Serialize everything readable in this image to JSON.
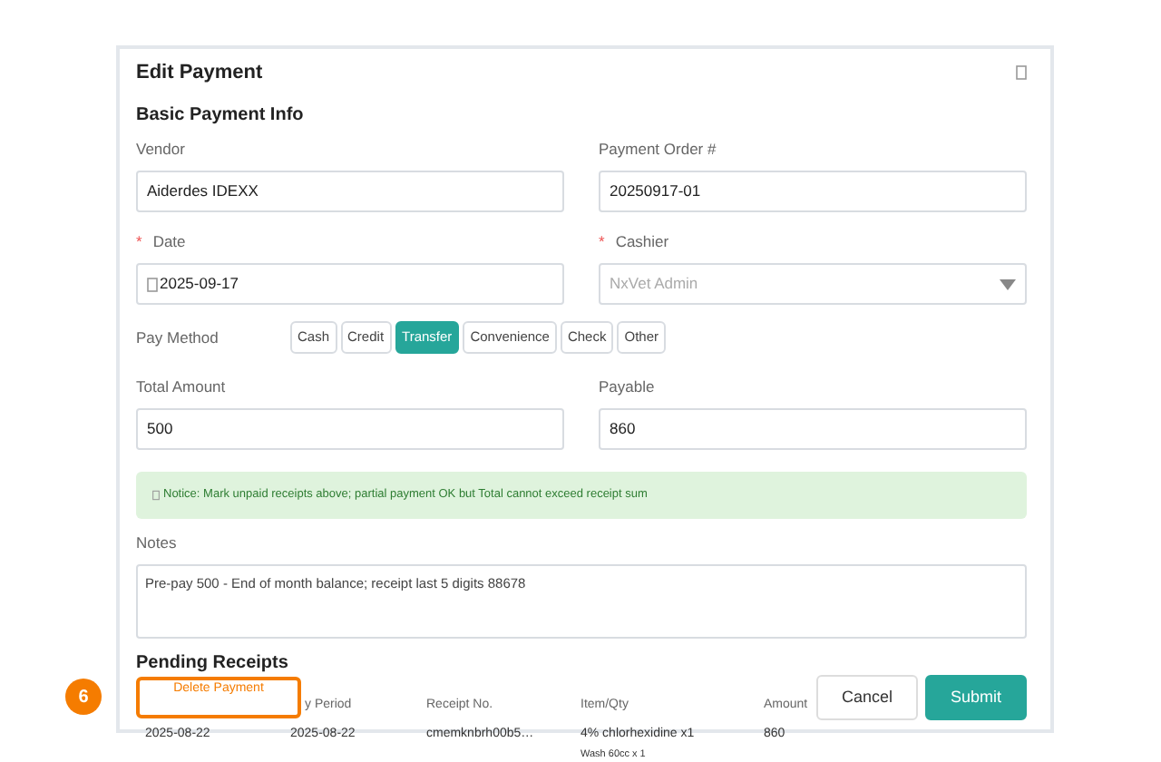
{
  "dialog": {
    "title": "Edit Payment"
  },
  "section": "Basic Payment Info",
  "fields": [
    {
      "label": "Vendor",
      "value": "Aiderdes IDEXX",
      "kind": "text"
    },
    {
      "label": "Payment Order #",
      "value": "20250917-01",
      "kind": "text"
    },
    {
      "label": "Date",
      "required_mark": "*",
      "value": "2025-09-17",
      "kind": "date"
    },
    {
      "label": "Cashier",
      "required_mark": "*",
      "value": "NxVet Admin",
      "kind": "select"
    }
  ],
  "pay_method": {
    "label": "Pay Method",
    "options": [
      {
        "label": "Cash",
        "selected": false
      },
      {
        "label": "Credit",
        "selected": false
      },
      {
        "label": "Transfer",
        "selected": true
      },
      {
        "label": "Convenience",
        "selected": false
      },
      {
        "label": "Check",
        "selected": false
      },
      {
        "label": "Other",
        "selected": false
      }
    ]
  },
  "amounts": [
    {
      "label": "Total Amount",
      "value": "500"
    },
    {
      "label": "Payable",
      "value": "860"
    }
  ],
  "notice": "Notice: Mark unpaid receipts above; partial payment OK but Total cannot exceed receipt sum",
  "notes": {
    "label": "Notes",
    "value": "Pre-pay 500 - End of month balance; receipt last 5 digits 88678"
  },
  "pending": {
    "title": "Pending Receipts",
    "columns": [
      "",
      "y Period",
      "Receipt No.",
      "Item/Qty",
      "Amount"
    ],
    "rows": [
      {
        "cells": [
          "2025-08-22",
          "2025-08-22",
          "cmemknbrh00b5…",
          "4% chlorhexidine x1",
          "860"
        ],
        "subline": "Wash 60cc x 1"
      }
    ]
  },
  "delete_button": {
    "label": "Delete Payment",
    "highlight_number": "6"
  },
  "buttons": [
    {
      "label": "Cancel",
      "kind": "secondary"
    },
    {
      "label": "Submit",
      "kind": "primary"
    }
  ]
}
